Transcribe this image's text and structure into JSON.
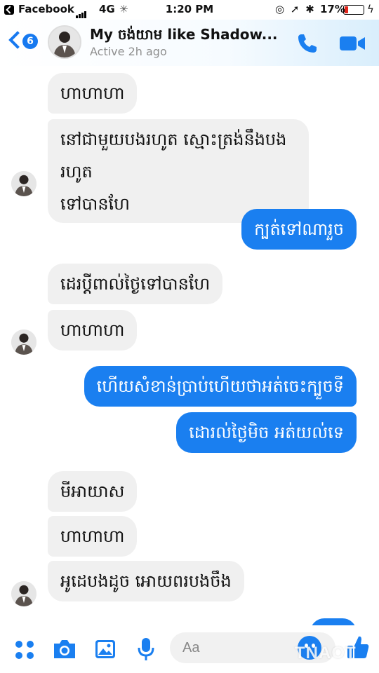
{
  "status_bar": {
    "carrier": "Facebook",
    "network": "4G",
    "time": "1:20 PM",
    "battery_percent": "17%",
    "battery_level": 0.17
  },
  "header": {
    "unread_count": "6",
    "contact_name": "My ចង់យាម like Shadow...",
    "active_status": "Active 2h ago"
  },
  "messages": [
    {
      "direction": "in",
      "text": "ហាហាហា"
    },
    {
      "direction": "in",
      "text": "នៅជាមួយបងរហូត ស្មោះត្រង់នឹងបងរហូត"
    },
    {
      "direction": "in",
      "text": "ទៅបានហែ"
    },
    {
      "direction": "out",
      "text": "ក្បត់ទៅណារួច"
    },
    {
      "direction": "in",
      "text": "ដេរប្តីពាល់ថ្ងៃទៅបានហែ"
    },
    {
      "direction": "in",
      "text": "ហាហាហា"
    },
    {
      "direction": "out",
      "text": "ហើយសំខាន់ប្រាប់ហើយថាអត់ចេះក្បួចទី"
    },
    {
      "direction": "out",
      "text": "ដោរល់ថ្ងៃមិច អត់យល់ទេ"
    },
    {
      "direction": "in",
      "text": "មីអាយាស"
    },
    {
      "direction": "in",
      "text": "ហាហាហា"
    },
    {
      "direction": "in",
      "text": "អូដេបងដូច អោយពរបងចឹង"
    }
  ],
  "composer": {
    "placeholder": "Aa"
  },
  "watermark": "TNAOT",
  "colors": {
    "accent": "#1a7ff0",
    "incoming_bubble": "#f0f0f0",
    "battery_low": "#e0251b"
  },
  "icons": {
    "apps": "apps-icon",
    "camera": "camera-icon",
    "photo": "photo-icon",
    "mic": "microphone-icon",
    "emoji": "emoji-icon",
    "like": "thumbs-up-icon",
    "call": "phone-icon",
    "video": "video-camera-icon"
  }
}
